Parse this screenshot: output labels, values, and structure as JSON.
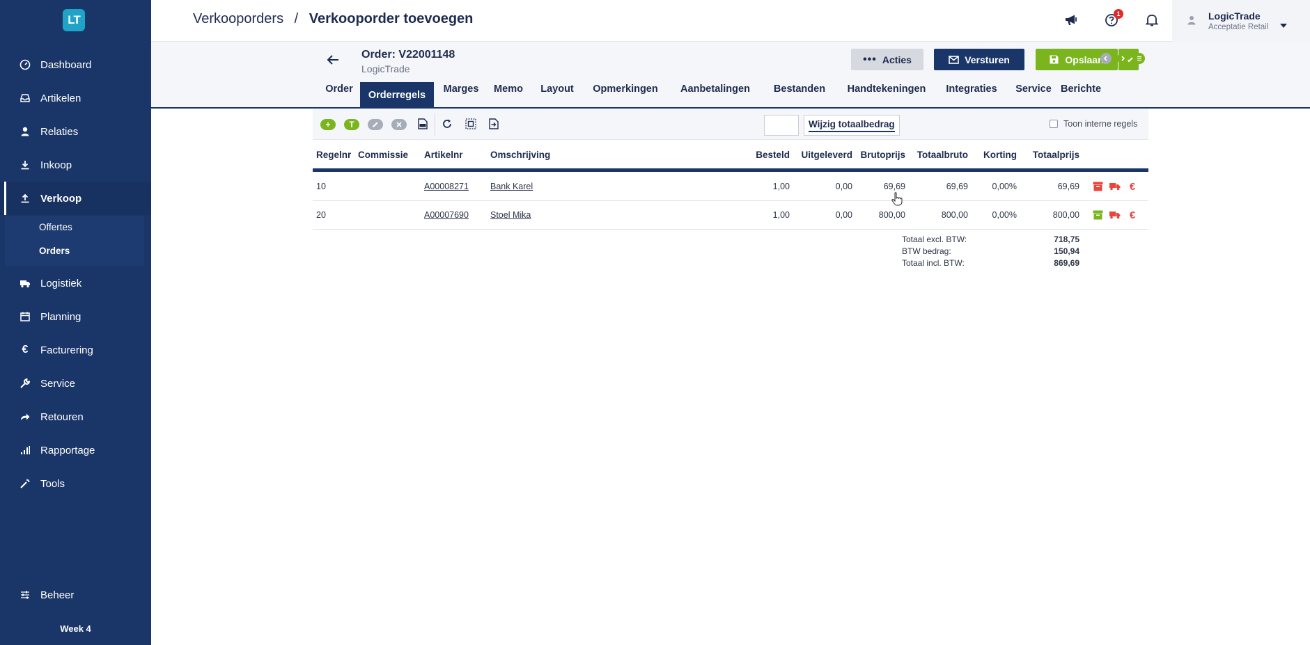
{
  "app": {
    "logo_text": "LT",
    "week": "Week 4"
  },
  "sidebar": {
    "items": [
      {
        "label": "Dashboard",
        "icon": "gauge-icon"
      },
      {
        "label": "Artikelen",
        "icon": "inbox-icon"
      },
      {
        "label": "Relaties",
        "icon": "person-icon"
      },
      {
        "label": "Inkoop",
        "icon": "download-icon"
      },
      {
        "label": "Verkoop",
        "icon": "upload-icon"
      },
      {
        "label": "Logistiek",
        "icon": "truck-icon"
      },
      {
        "label": "Planning",
        "icon": "calendar-icon"
      },
      {
        "label": "Facturering",
        "icon": "euro-icon"
      },
      {
        "label": "Service",
        "icon": "wrench-icon"
      },
      {
        "label": "Retouren",
        "icon": "share-icon"
      },
      {
        "label": "Rapportage",
        "icon": "bar-chart-icon"
      },
      {
        "label": "Tools",
        "icon": "magic-wand-icon"
      },
      {
        "label": "Beheer",
        "icon": "sliders-icon"
      }
    ],
    "sub_items": [
      {
        "label": "Offertes"
      },
      {
        "label": "Orders"
      }
    ]
  },
  "header": {
    "breadcrumb_parent": "Verkooporders",
    "breadcrumb_sep": "/",
    "breadcrumb_current": "Verkooporder toevoegen",
    "notification_count": "1",
    "user_name": "LogicTrade",
    "user_org": "Acceptatie Retail"
  },
  "order": {
    "title": "Order: V22001148",
    "customer": "LogicTrade",
    "actions": {
      "acties": "Acties",
      "versturen": "Versturen",
      "opslaan": "Opslaan"
    },
    "tabs": [
      {
        "label": "Order"
      },
      {
        "label": "Orderregels"
      },
      {
        "label": "Marges"
      },
      {
        "label": "Memo"
      },
      {
        "label": "Layout"
      },
      {
        "label": "Opmerkingen"
      },
      {
        "label": "Aanbetalingen"
      },
      {
        "label": "Bestanden"
      },
      {
        "label": "Handtekeningen"
      },
      {
        "label": "Integraties"
      },
      {
        "label": "Service"
      },
      {
        "label": "Berichte"
      }
    ]
  },
  "toolbar": {
    "add_text_label": "T",
    "totaal_value": "",
    "wijzig_label": "Wijzig totaalbedrag",
    "interne_label": "Toon interne regels"
  },
  "table": {
    "columns": [
      "Regelnr",
      "Commissie",
      "Artikelnr",
      "Omschrijving",
      "Besteld",
      "Uitgeleverd",
      "Brutoprijs",
      "Totaalbruto",
      "Korting",
      "Totaalprijs"
    ],
    "rows": [
      {
        "regelnr": "10",
        "commissie": "",
        "artikelnr": "A00008271",
        "omschrijving": "Bank Karel",
        "besteld": "1,00",
        "uitgeleverd": "0,00",
        "brutoprijs": "69,69",
        "totaalbruto": "69,69",
        "korting": "0,00%",
        "totaalprijs": "69,69",
        "stock_color": "#e8453c"
      },
      {
        "regelnr": "20",
        "commissie": "",
        "artikelnr": "A00007690",
        "omschrijving": "Stoel Mika",
        "besteld": "1,00",
        "uitgeleverd": "0,00",
        "brutoprijs": "800,00",
        "totaalbruto": "800,00",
        "korting": "0,00%",
        "totaalprijs": "800,00",
        "stock_color": "#7ab51d"
      }
    ],
    "totals": [
      {
        "label": "Totaal excl. BTW:",
        "value": "718,75"
      },
      {
        "label": "BTW bedrag:",
        "value": "150,94"
      },
      {
        "label": "Totaal incl. BTW:",
        "value": "869,69"
      }
    ]
  },
  "colors": {
    "navy": "#1a3668",
    "green": "#7ab51d",
    "red": "#e8453c",
    "logo": "#1fa3c7"
  }
}
